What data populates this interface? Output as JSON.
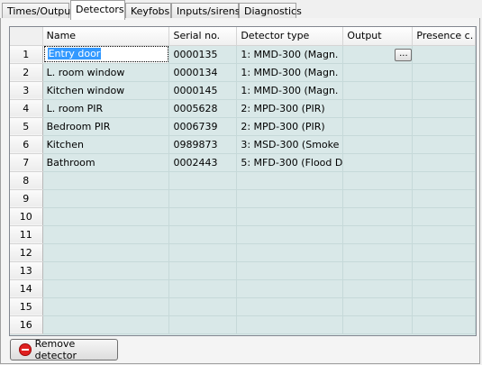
{
  "tabs": [
    "Times/Outpus",
    "Detectors",
    "Keyfobs",
    "Inputs/sirens",
    "Diagnostics"
  ],
  "active_tab": "Detectors",
  "columns": [
    "Name",
    "Serial no.",
    "Detector type",
    "Output",
    "Presence c."
  ],
  "rows": [
    {
      "num": "1",
      "name": "Entry door",
      "serial": "0000135",
      "type": "1: MMD-300 (Magn."
    },
    {
      "num": "2",
      "name": "L. room window",
      "serial": "0000134",
      "type": "1: MMD-300 (Magn."
    },
    {
      "num": "3",
      "name": "Kitchen window",
      "serial": "0000145",
      "type": "1: MMD-300 (Magn."
    },
    {
      "num": "4",
      "name": "L. room PIR",
      "serial": "0005628",
      "type": "2: MPD-300 (PIR)"
    },
    {
      "num": "5",
      "name": "Bedroom PIR",
      "serial": "0006739",
      "type": "2: MPD-300 (PIR)"
    },
    {
      "num": "6",
      "name": "Kitchen",
      "serial": "0989873",
      "type": "3: MSD-300 (Smoke"
    },
    {
      "num": "7",
      "name": "Bathroom",
      "serial": "0002443",
      "type": "5: MFD-300 (Flood D"
    },
    {
      "num": "8",
      "name": "",
      "serial": "",
      "type": ""
    },
    {
      "num": "9",
      "name": "",
      "serial": "",
      "type": ""
    },
    {
      "num": "10",
      "name": "",
      "serial": "",
      "type": ""
    },
    {
      "num": "11",
      "name": "",
      "serial": "",
      "type": ""
    },
    {
      "num": "12",
      "name": "",
      "serial": "",
      "type": ""
    },
    {
      "num": "13",
      "name": "",
      "serial": "",
      "type": ""
    },
    {
      "num": "14",
      "name": "",
      "serial": "",
      "type": ""
    },
    {
      "num": "15",
      "name": "",
      "serial": "",
      "type": ""
    },
    {
      "num": "16",
      "name": "",
      "serial": "",
      "type": ""
    }
  ],
  "ellipsis_label": "...",
  "remove_button": {
    "label": "Remove detector",
    "icon": "remove-circle-icon"
  },
  "colors": {
    "grid_bg": "#d9e8e8",
    "selection": "#3399ff",
    "remove_icon": "#e02020"
  }
}
